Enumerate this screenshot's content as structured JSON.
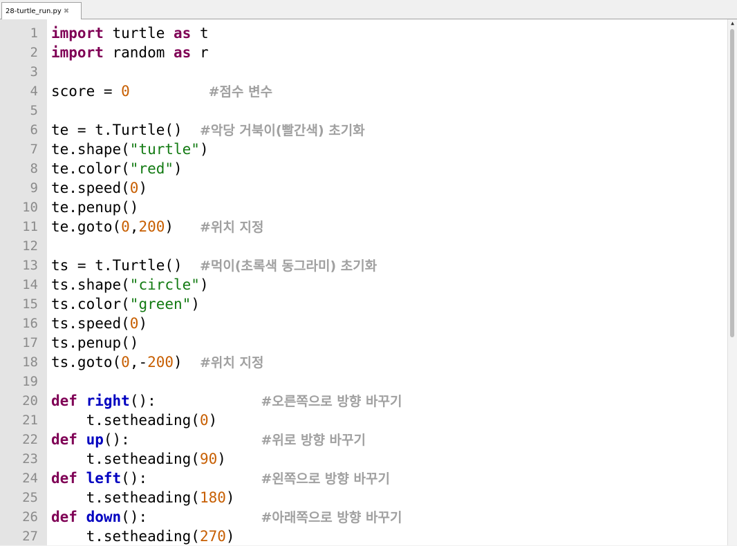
{
  "tab": {
    "title": "28-turtle_run.py",
    "close_glyph": "✖"
  },
  "editor": {
    "lines": [
      {
        "n": "1",
        "tokens": [
          {
            "k": "kw",
            "t": "import"
          },
          {
            "k": "p",
            "t": " turtle "
          },
          {
            "k": "kw",
            "t": "as"
          },
          {
            "k": "p",
            "t": " t"
          }
        ]
      },
      {
        "n": "2",
        "tokens": [
          {
            "k": "kw",
            "t": "import"
          },
          {
            "k": "p",
            "t": " random "
          },
          {
            "k": "kw",
            "t": "as"
          },
          {
            "k": "p",
            "t": " r"
          }
        ]
      },
      {
        "n": "3",
        "tokens": []
      },
      {
        "n": "4",
        "tokens": [
          {
            "k": "p",
            "t": "score = "
          },
          {
            "k": "num",
            "t": "0"
          },
          {
            "k": "p",
            "t": "         "
          },
          {
            "k": "cm",
            "t": "#점수 변수"
          }
        ]
      },
      {
        "n": "5",
        "tokens": []
      },
      {
        "n": "6",
        "tokens": [
          {
            "k": "p",
            "t": "te = t.Turtle()  "
          },
          {
            "k": "cm",
            "t": "#악당 거북이(빨간색) 초기화"
          }
        ]
      },
      {
        "n": "7",
        "tokens": [
          {
            "k": "p",
            "t": "te.shape("
          },
          {
            "k": "str",
            "t": "\"turtle\""
          },
          {
            "k": "p",
            "t": ")"
          }
        ]
      },
      {
        "n": "8",
        "tokens": [
          {
            "k": "p",
            "t": "te.color("
          },
          {
            "k": "str",
            "t": "\"red\""
          },
          {
            "k": "p",
            "t": ")"
          }
        ]
      },
      {
        "n": "9",
        "tokens": [
          {
            "k": "p",
            "t": "te.speed("
          },
          {
            "k": "num",
            "t": "0"
          },
          {
            "k": "p",
            "t": ")"
          }
        ]
      },
      {
        "n": "10",
        "tokens": [
          {
            "k": "p",
            "t": "te.penup()"
          }
        ]
      },
      {
        "n": "11",
        "tokens": [
          {
            "k": "p",
            "t": "te.goto("
          },
          {
            "k": "num",
            "t": "0"
          },
          {
            "k": "p",
            "t": ","
          },
          {
            "k": "num",
            "t": "200"
          },
          {
            "k": "p",
            "t": ")   "
          },
          {
            "k": "cm",
            "t": "#위치 지정"
          }
        ]
      },
      {
        "n": "12",
        "tokens": []
      },
      {
        "n": "13",
        "tokens": [
          {
            "k": "p",
            "t": "ts = t.Turtle()  "
          },
          {
            "k": "cm",
            "t": "#먹이(초록색 동그라미) 초기화"
          }
        ]
      },
      {
        "n": "14",
        "tokens": [
          {
            "k": "p",
            "t": "ts.shape("
          },
          {
            "k": "str",
            "t": "\"circle\""
          },
          {
            "k": "p",
            "t": ")"
          }
        ]
      },
      {
        "n": "15",
        "tokens": [
          {
            "k": "p",
            "t": "ts.color("
          },
          {
            "k": "str",
            "t": "\"green\""
          },
          {
            "k": "p",
            "t": ")"
          }
        ]
      },
      {
        "n": "16",
        "tokens": [
          {
            "k": "p",
            "t": "ts.speed("
          },
          {
            "k": "num",
            "t": "0"
          },
          {
            "k": "p",
            "t": ")"
          }
        ]
      },
      {
        "n": "17",
        "tokens": [
          {
            "k": "p",
            "t": "ts.penup()"
          }
        ]
      },
      {
        "n": "18",
        "tokens": [
          {
            "k": "p",
            "t": "ts.goto("
          },
          {
            "k": "num",
            "t": "0"
          },
          {
            "k": "p",
            "t": ",-"
          },
          {
            "k": "num",
            "t": "200"
          },
          {
            "k": "p",
            "t": ")  "
          },
          {
            "k": "cm",
            "t": "#위치 지정"
          }
        ]
      },
      {
        "n": "19",
        "tokens": []
      },
      {
        "n": "20",
        "tokens": [
          {
            "k": "kw",
            "t": "def"
          },
          {
            "k": "p",
            "t": " "
          },
          {
            "k": "fn",
            "t": "right"
          },
          {
            "k": "p",
            "t": "():            "
          },
          {
            "k": "cm",
            "t": "#오른쪽으로 방향 바꾸기"
          }
        ]
      },
      {
        "n": "21",
        "tokens": [
          {
            "k": "p",
            "t": "    t.setheading("
          },
          {
            "k": "num",
            "t": "0"
          },
          {
            "k": "p",
            "t": ")"
          }
        ]
      },
      {
        "n": "22",
        "tokens": [
          {
            "k": "kw",
            "t": "def"
          },
          {
            "k": "p",
            "t": " "
          },
          {
            "k": "fn",
            "t": "up"
          },
          {
            "k": "p",
            "t": "():               "
          },
          {
            "k": "cm",
            "t": "#위로 방향 바꾸기"
          }
        ]
      },
      {
        "n": "23",
        "tokens": [
          {
            "k": "p",
            "t": "    t.setheading("
          },
          {
            "k": "num",
            "t": "90"
          },
          {
            "k": "p",
            "t": ")"
          }
        ]
      },
      {
        "n": "24",
        "tokens": [
          {
            "k": "kw",
            "t": "def"
          },
          {
            "k": "p",
            "t": " "
          },
          {
            "k": "fn",
            "t": "left"
          },
          {
            "k": "p",
            "t": "():             "
          },
          {
            "k": "cm",
            "t": "#왼쪽으로 방향 바꾸기"
          }
        ]
      },
      {
        "n": "25",
        "tokens": [
          {
            "k": "p",
            "t": "    t.setheading("
          },
          {
            "k": "num",
            "t": "180"
          },
          {
            "k": "p",
            "t": ")"
          }
        ]
      },
      {
        "n": "26",
        "tokens": [
          {
            "k": "kw",
            "t": "def"
          },
          {
            "k": "p",
            "t": " "
          },
          {
            "k": "fn",
            "t": "down"
          },
          {
            "k": "p",
            "t": "():             "
          },
          {
            "k": "cm",
            "t": "#아래쪽으로 방향 바꾸기"
          }
        ]
      },
      {
        "n": "27",
        "tokens": [
          {
            "k": "p",
            "t": "    t.setheading("
          },
          {
            "k": "num",
            "t": "270"
          },
          {
            "k": "p",
            "t": ")"
          }
        ]
      }
    ]
  }
}
